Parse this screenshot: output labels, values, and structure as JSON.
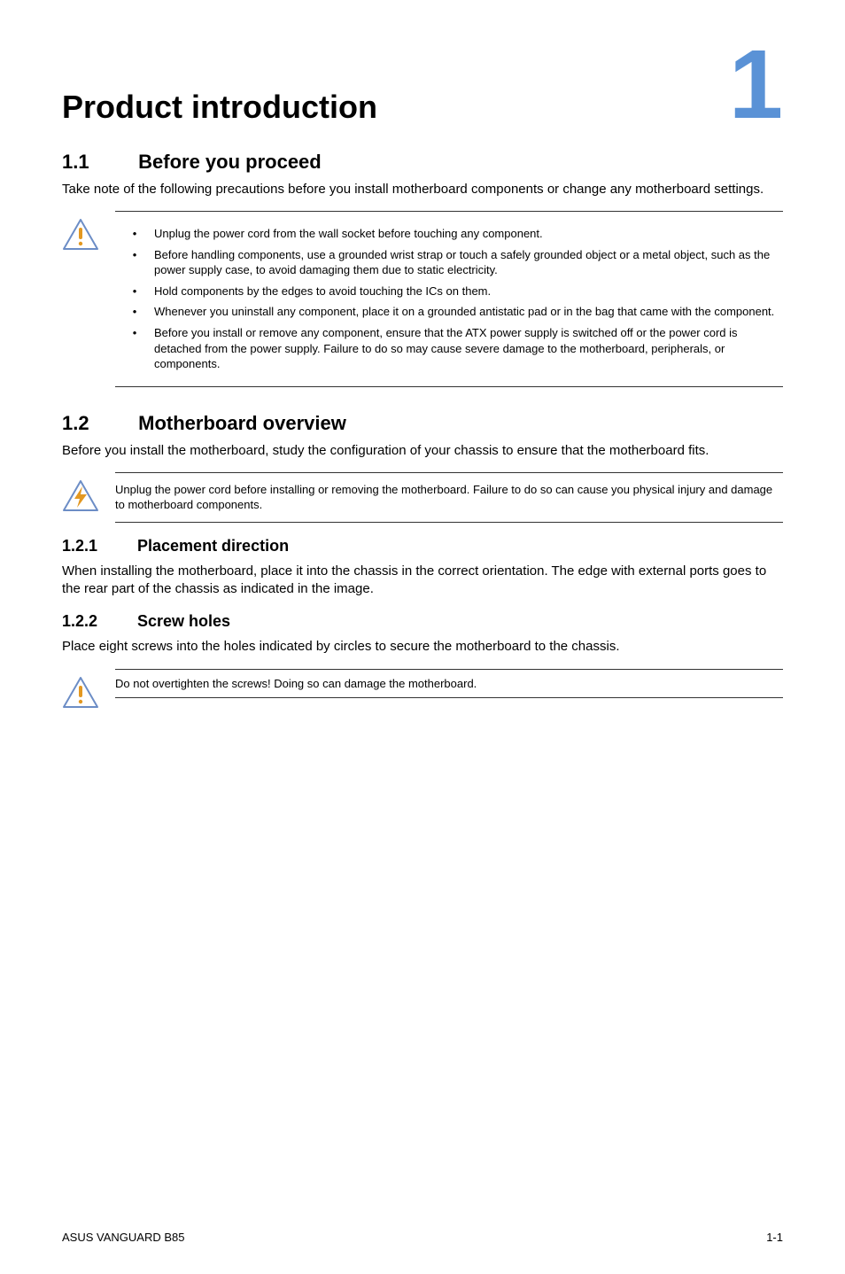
{
  "chapter": {
    "title": "Product introduction",
    "number": "1"
  },
  "sec1": {
    "num": "1.1",
    "title": "Before you proceed",
    "intro": "Take note of the following precautions before you install motherboard components or change any motherboard settings."
  },
  "precautions": [
    "Unplug the power cord from the wall socket before touching any component.",
    "Before handling components, use a grounded wrist strap or touch a safely grounded object or a metal object, such as the power supply case, to avoid damaging them due to static electricity.",
    "Hold components by the edges to avoid touching the ICs on them.",
    "Whenever you uninstall any component, place it on a grounded antistatic pad or in the bag that came with the component.",
    "Before you install or remove any component, ensure that the ATX power supply is switched off or the power cord is detached from the power supply. Failure to do so may cause severe damage to the motherboard, peripherals, or components."
  ],
  "sec2": {
    "num": "1.2",
    "title": "Motherboard overview",
    "intro": "Before you install the motherboard, study the configuration of your chassis to ensure that the motherboard fits."
  },
  "danger_note": "Unplug the power cord before installing or removing the motherboard. Failure to do so can cause you physical injury and damage to motherboard components.",
  "sub1": {
    "num": "1.2.1",
    "title": "Placement direction",
    "body": "When installing the motherboard, place it into the chassis in the correct orientation. The edge with external ports goes to the rear part of the chassis as indicated in the image."
  },
  "sub2": {
    "num": "1.2.2",
    "title": "Screw holes",
    "body": "Place eight screws into the holes indicated by circles to secure the motherboard to the chassis."
  },
  "caution_note": "Do not overtighten the screws! Doing so can damage the motherboard.",
  "footer": {
    "left": "ASUS VANGUARD B85",
    "right": "1-1"
  }
}
